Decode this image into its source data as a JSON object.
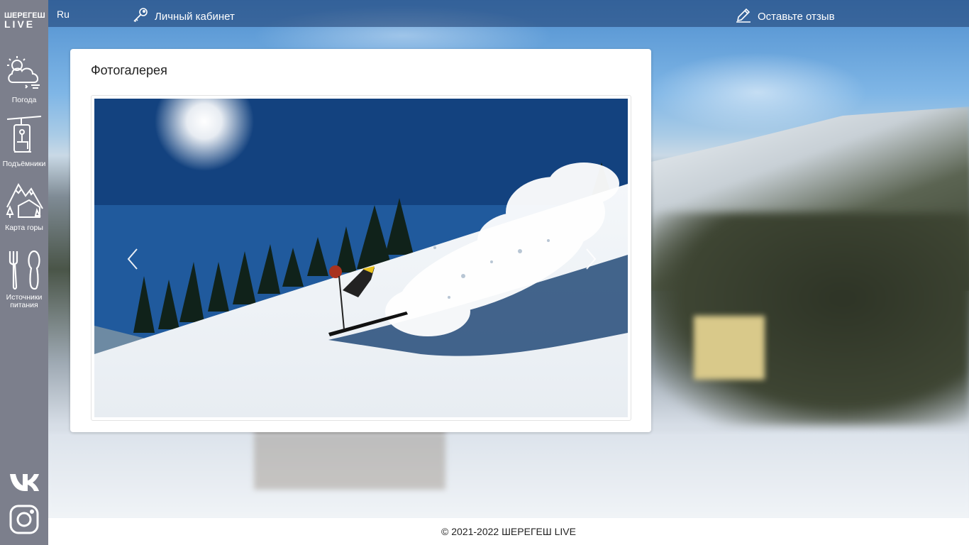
{
  "topbar": {
    "lang": "Ru",
    "cabinet_label": "Личный кабинет",
    "feedback_label": "Оставьте отзыв"
  },
  "sidebar": {
    "logo_line1": "ШЕРЕГЕШ",
    "logo_line2": "LIVE",
    "items": [
      {
        "label": "Погода",
        "icon": "weather-icon"
      },
      {
        "label": "Подъёмники",
        "icon": "ski-lift-icon"
      },
      {
        "label": "Карта горы",
        "icon": "mountain-map-icon"
      },
      {
        "label": "Источники питания",
        "icon": "food-icon"
      }
    ],
    "social": [
      "vk-icon",
      "instagram-icon"
    ]
  },
  "gallery": {
    "title": "Фотогалерея",
    "prev_icon": "chevron-left-icon",
    "next_icon": "chevron-right-icon"
  },
  "footer": {
    "copyright": "© 2021-2022 ШЕРЕГЕШ LIVE"
  },
  "colors": {
    "sidebar": "#7c7f8c",
    "topbar": "#2e4f80",
    "card": "#ffffff"
  }
}
